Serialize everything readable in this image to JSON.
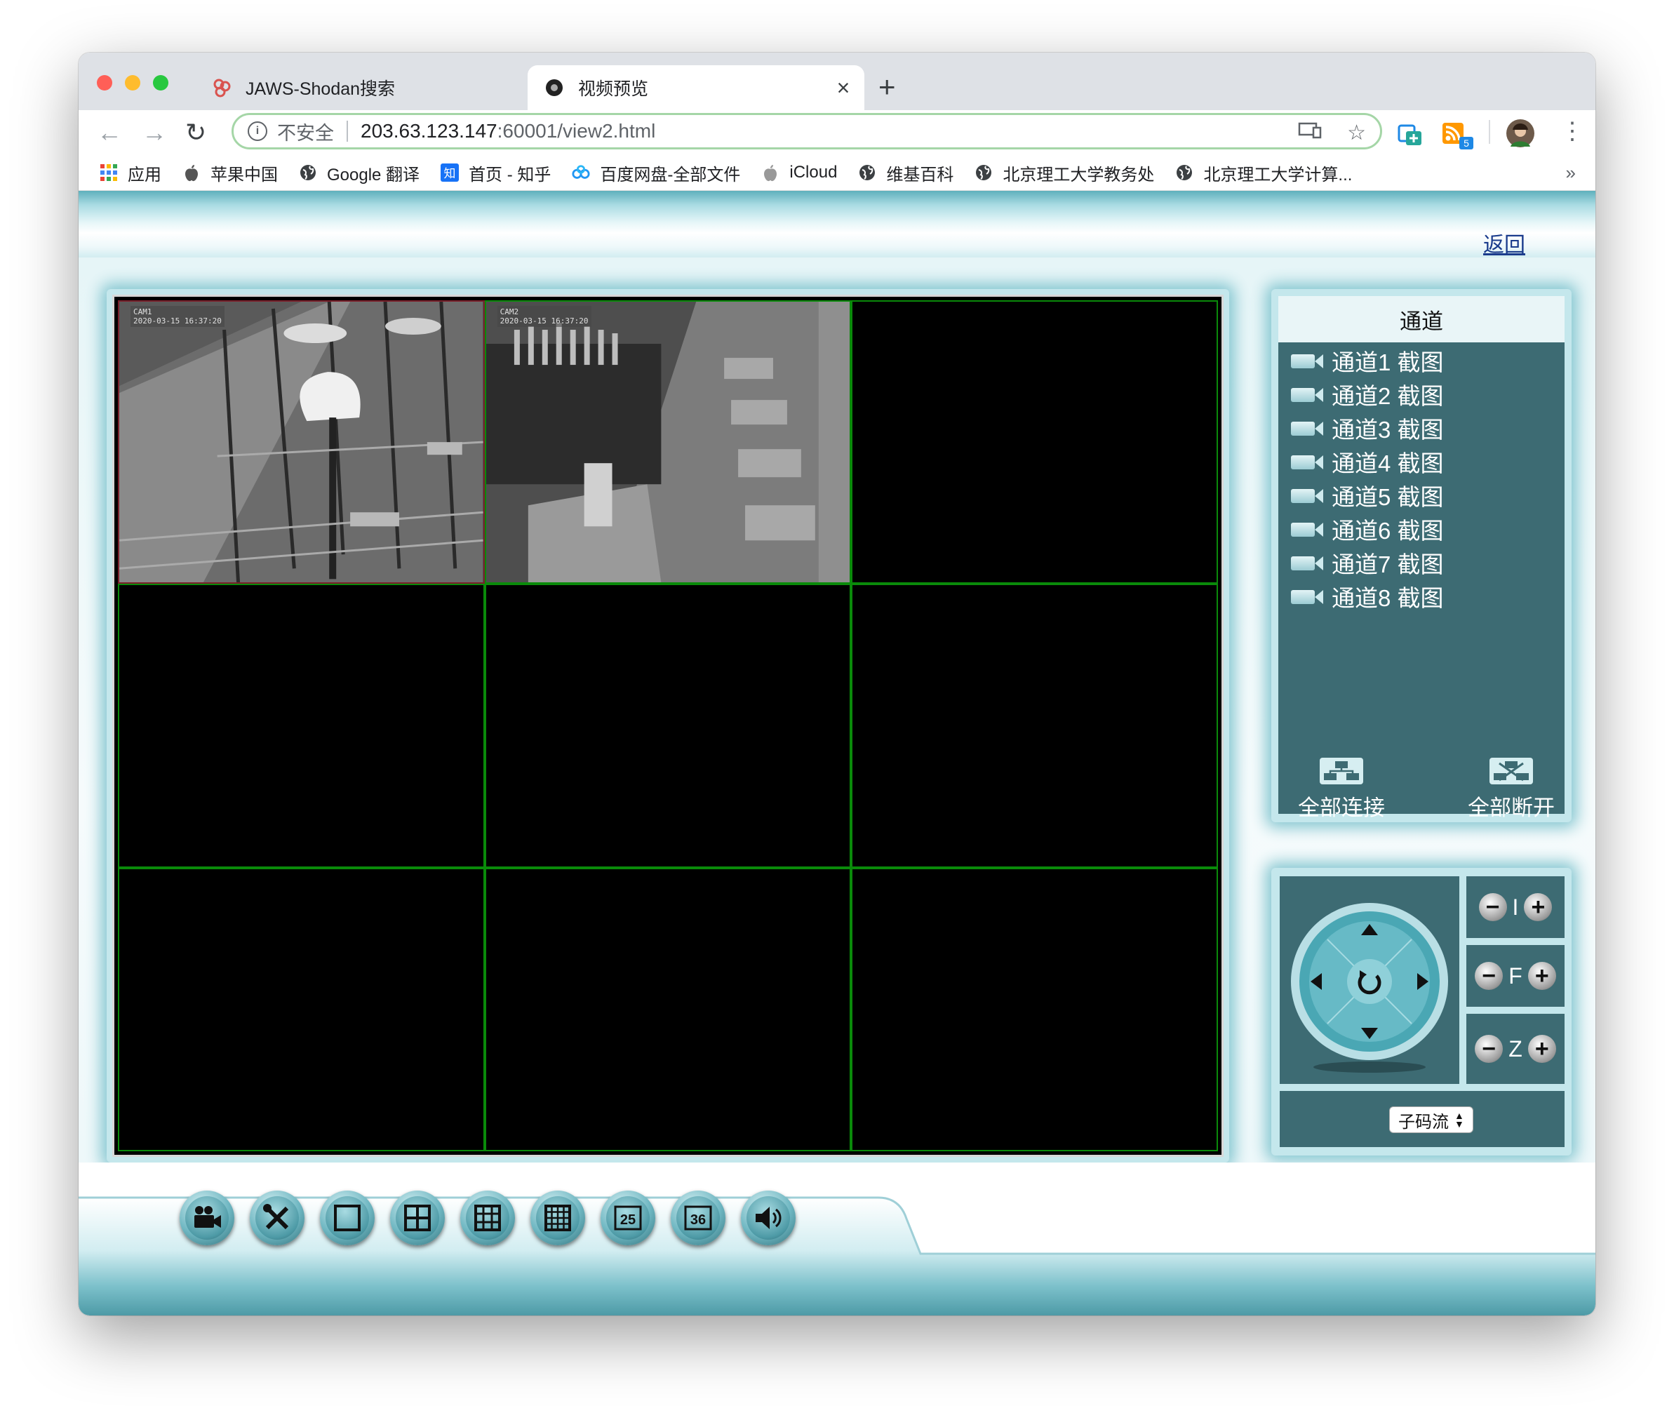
{
  "browser": {
    "tabs": [
      {
        "title": "JAWS-Shodan搜索",
        "close": "×",
        "active": false
      },
      {
        "title": "视频预览",
        "close": "×",
        "active": true
      }
    ],
    "new_tab": "+",
    "address": {
      "security_label": "不安全",
      "url_host": "203.63.123.147",
      "url_path": ":60001/view2.html"
    },
    "extension_badge": "5",
    "bookmarks": [
      {
        "label": "应用",
        "icon": "apps-grid-icon"
      },
      {
        "label": "苹果中国",
        "icon": "apple-icon"
      },
      {
        "label": "Google 翻译",
        "icon": "globe-icon"
      },
      {
        "label": "首页 - 知乎",
        "icon": "zhihu-icon"
      },
      {
        "label": "百度网盘-全部文件",
        "icon": "baidu-netdisk-icon"
      },
      {
        "label": "iCloud",
        "icon": "apple-icon"
      },
      {
        "label": "维基百科",
        "icon": "globe-icon"
      },
      {
        "label": "北京理工大学教务处",
        "icon": "globe-icon"
      },
      {
        "label": "北京理工大学计算...",
        "icon": "globe-icon"
      }
    ],
    "bookmarks_more": "»"
  },
  "page": {
    "back_link": "返回",
    "video_grid": {
      "layout": "3x3",
      "cells": [
        {
          "state": "live",
          "osd": [
            "CAM1",
            "2020-03-15 16:37:20"
          ]
        },
        {
          "state": "live",
          "osd": [
            "CAM2",
            "2020-03-15 16:37:20"
          ]
        },
        {
          "state": "empty"
        },
        {
          "state": "empty"
        },
        {
          "state": "empty"
        },
        {
          "state": "empty"
        },
        {
          "state": "empty"
        },
        {
          "state": "empty"
        },
        {
          "state": "empty"
        }
      ]
    },
    "channel_panel": {
      "title": "通道",
      "channels": [
        {
          "name": "通道1",
          "snapshot": "截图"
        },
        {
          "name": "通道2",
          "snapshot": "截图"
        },
        {
          "name": "通道3",
          "snapshot": "截图"
        },
        {
          "name": "通道4",
          "snapshot": "截图"
        },
        {
          "name": "通道5",
          "snapshot": "截图"
        },
        {
          "name": "通道6",
          "snapshot": "截图"
        },
        {
          "name": "通道7",
          "snapshot": "截图"
        },
        {
          "name": "通道8",
          "snapshot": "截图"
        }
      ],
      "connect_all": "全部连接",
      "disconnect_all": "全部断开"
    },
    "ptz": {
      "iris_label": "I",
      "focus_label": "F",
      "zoom_label": "Z",
      "stream_select": "子码流"
    },
    "bottom_toolbar": {
      "buttons": [
        {
          "icon": "record-camera-icon"
        },
        {
          "icon": "settings-tools-icon"
        },
        {
          "icon": "layout-1-icon"
        },
        {
          "icon": "layout-4-icon"
        },
        {
          "icon": "layout-9-icon"
        },
        {
          "icon": "layout-16-icon"
        },
        {
          "icon": "layout-25-icon",
          "label": "25"
        },
        {
          "icon": "layout-36-icon",
          "label": "36"
        },
        {
          "icon": "volume-icon"
        }
      ]
    }
  },
  "colors": {
    "panel_teal": "#3d6b73",
    "frame_light": "#c4e7ec",
    "grid_border": "#0a8a0a",
    "link": "#1a3b8c"
  }
}
